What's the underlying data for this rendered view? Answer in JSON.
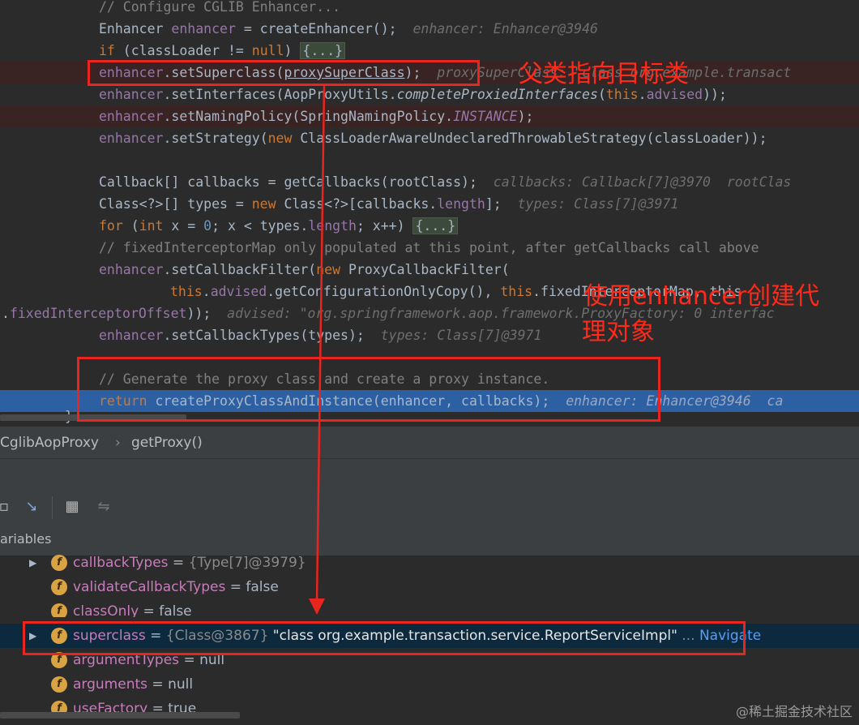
{
  "editor": {
    "l0": "// Configure CGLIB Enhancer...",
    "l1_a": "Enhancer ",
    "l1_var": "enhancer",
    "l1_b": " = createEnhancer();",
    "l1_hint": "enhancer: Enhancer@3946",
    "l2_kw": "if",
    "l2_b": " (classLoader != ",
    "l2_null": "null",
    "l2_c": ") ",
    "l2_fold": "{...}",
    "l3_a": "enhancer",
    "l3_b": ".setSuperclass(",
    "l3_c": "proxySuperClass",
    "l3_d": ");",
    "l3_hint": "proxySuperClass: \"class org.example.transact",
    "l4_a": "enhancer",
    "l4_b": ".setInterfaces(AopProxyUtils.",
    "l4_c": "completeProxiedInterfaces",
    "l4_d": "(",
    "l4_e": "this",
    "l4_f": ".",
    "l4_g": "advised",
    "l4_h": "));",
    "l5_a": "enhancer",
    "l5_b": ".setNamingPolicy(SpringNamingPolicy.",
    "l5_c": "INSTANCE",
    "l5_d": ");",
    "l6_a": "enhancer",
    "l6_b": ".setStrategy(",
    "l6_new": "new",
    "l6_c": " ClassLoaderAwareUndeclaredThrowableStrategy(classLoader));",
    "l8_a": "Callback[] callbacks = getCallbacks(rootClass);",
    "l8_hint": "callbacks: Callback[7]@3970  rootClas",
    "l9_a": "Class<?>[] types = ",
    "l9_new": "new",
    "l9_b": " Class<?>[callbacks.",
    "l9_c": "length",
    "l9_d": "];",
    "l9_hint": "types: Class[7]@3971",
    "l10_kw": "for",
    "l10_b": " (",
    "l10_int": "int",
    "l10_c": " x = ",
    "l10_num": "0",
    "l10_d": "; x < types.",
    "l10_e": "length",
    "l10_f": "; x++) ",
    "l10_fold": "{...}",
    "l11": "// fixedInterceptorMap only populated at this point, after getCallbacks call above",
    "l12_a": "enhancer",
    "l12_b": ".setCallbackFilter(",
    "l12_new": "new",
    "l12_c": " ProxyCallbackFilter(",
    "l13_a": "this",
    "l13_b": ".",
    "l13_c": "advised",
    "l13_d": ".getConfigurationOnlyCopy(), ",
    "l13_e": "this",
    "l13_f": ".fixedInterceptorMap, this",
    "l14_a": ".",
    "l14_b": "fixedInterceptorOffset",
    "l14_c": "));",
    "l14_hint": "advised: \"org.springframework.aop.framework.ProxyFactory: 0 interfac",
    "l15_a": "enhancer",
    "l15_b": ".setCallbackTypes(types);",
    "l15_hint": "types: Class[7]@3971",
    "l17": "// Generate the proxy class and create a proxy instance.",
    "l18_kw": "return",
    "l18_b": " createProxyClassAndInstance(enhancer, callbacks);",
    "l18_hint": "enhancer: Enhancer@3946  ca",
    "l19": "}"
  },
  "annotations": {
    "superclass_note": "父类指向目标类",
    "enhancer_note_1": "使用enhancer创建代",
    "enhancer_note_2": "理对象"
  },
  "breadcrumb": {
    "class": "CglibAopProxy",
    "sep": "›",
    "method": "getProxy()"
  },
  "variables_title": "ariables",
  "variables": [
    {
      "name": "callbackTypes",
      "eq": " = ",
      "ref": "{Type[7]@3979}",
      "expand": "▶"
    },
    {
      "name": "validateCallbackTypes",
      "eq": " = ",
      "val": "false"
    },
    {
      "name": "classOnly",
      "eq": " = ",
      "val": "false"
    },
    {
      "name": "superclass",
      "eq": " = ",
      "ref": "{Class@3867}",
      "str": "\"class org.example.transaction.service.ReportServiceImpl\"",
      "ell": " ... ",
      "nav": "Navigate",
      "expand": "▶"
    },
    {
      "name": "argumentTypes",
      "eq": " = ",
      "val": "null"
    },
    {
      "name": "arguments",
      "eq": " = ",
      "val": "null"
    },
    {
      "name": "useFactory",
      "eq": " = ",
      "val": "true"
    }
  ],
  "field_icon_letter": "f",
  "watermark": "@稀土掘金技术社区",
  "colors": {
    "annotation_red": "#e8251f",
    "exec_line": "#2d5fa3",
    "field_name": "#c77dbb",
    "navigate": "#589df6"
  },
  "icons": [
    "step-into-icon",
    "table-icon",
    "compare-icon",
    "field-icon",
    "expand-triangle-icon"
  ]
}
